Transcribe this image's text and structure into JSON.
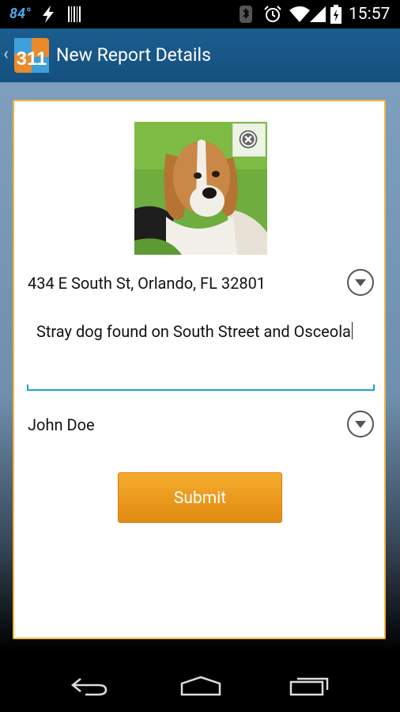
{
  "status_bar": {
    "temperature": "84°",
    "time": "15:57"
  },
  "action_bar": {
    "logo_text": "311",
    "title": "New Report Details"
  },
  "report": {
    "photo_alt": "beagle puppy photo",
    "address": "434 E South St, Orlando, FL 32801",
    "description": "Stray dog found on South Street and Osceola",
    "name": "John Doe",
    "submit_label": "Submit"
  },
  "icons": {
    "bolt": "lightning-icon",
    "barcode": "barcode-icon",
    "bluetooth": "bluetooth-icon",
    "alarm": "alarm-icon",
    "wifi": "wifi-icon",
    "signal": "signal-icon",
    "battery": "battery-icon",
    "remove_photo": "close-circle-icon",
    "dropdown": "chevron-down-circle-icon",
    "nav_back": "back-icon",
    "nav_home": "home-icon",
    "nav_recent": "recent-apps-icon"
  },
  "colors": {
    "action_bar": "#14507e",
    "accent_border": "#f2b33a",
    "submit": "#f0a020",
    "input_underline": "#1fa0d8"
  }
}
